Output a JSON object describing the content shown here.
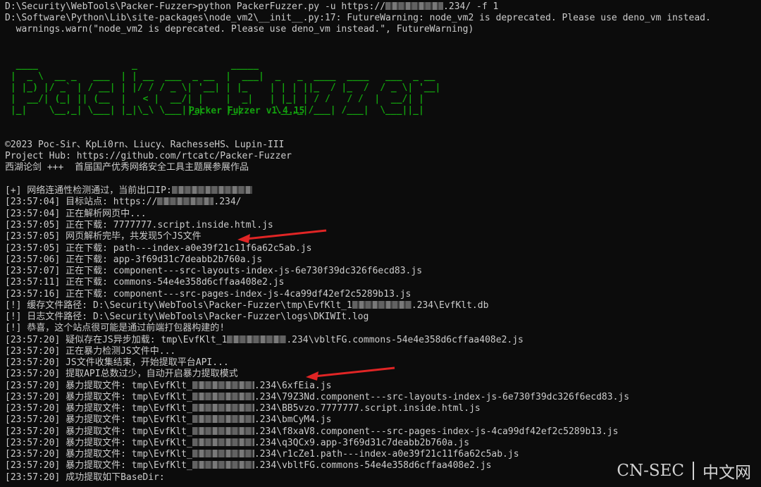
{
  "theme": {
    "background": "#0c0c0c",
    "foreground": "#cccccc",
    "banner_color": "#13a10e",
    "arrow_color": "#e02525"
  },
  "lines": [
    "D:\\Security\\WebTools\\Packer-Fuzzer>python PackerFuzzer.py -u https://",
    "D:\\Software\\Python\\Lib\\site-packages\\node_vm2\\__init__.py:17: FutureWarning: node_vm2 is deprecated. Please use deno_vm instead.",
    "  warnings.warn(\"node_vm2 is deprecated. Please use deno_vm instead.\", FutureWarning)",
    "©2023 Poc-Sir、KpLi0rn、Liucy、RachesseHS、Lupin-III",
    "Project Hub: https://github.com/rtcatc/Packer-Fuzzer",
    "西湖论剑 +++  首届国产优秀网络安全工具主题展参展作品",
    "[+] 网络连通性检测通过，当前出口IP:",
    "[23:57:04] 目标站点: https://",
    "[23:57:04] 正在解析网页中...",
    "[23:57:05] 正在下载: 7777777.script.inside.html.js",
    "[23:57:05] 网页解析完毕，共发现5个JS文件",
    "[23:57:05] 正在下载: path---index-a0e39f21c11f6a62c5ab.js",
    "[23:57:06] 正在下载: app-3f69d31c7deabb2b760a.js",
    "[23:57:07] 正在下载: component---src-layouts-index-js-6e730f39dc326f6ecd83.js",
    "[23:57:11] 正在下载: commons-54e4e358d6cffaa408e2.js",
    "[23:57:16] 正在下载: component---src-pages-index-js-4ca99df42ef2c5289b13.js",
    "[!] 缓存文件路径: D:\\Security\\WebTools\\Packer-Fuzzer\\tmp\\EvfKlt_1",
    "[!] 日志文件路径: D:\\Security\\WebTools\\Packer-Fuzzer\\logs\\DKIWIt.log",
    "[!] 恭喜，这个站点很可能是通过前端打包器构建的!",
    "[23:57:20] 疑似存在JS异步加载: tmp\\EvfKlt_1",
    "[23:57:20] 正在暴力检测JS文件中...",
    "[23:57:20] JS文件收集结束，开始提取平台API...",
    "[23:57:20] 提取API总数过少，自动开启暴力提取模式",
    "[23:57:20] 暴力提取文件: tmp\\EvfKlt_",
    "[23:57:20] 暴力提取文件: tmp\\EvfKlt_",
    "[23:57:20] 暴力提取文件: tmp\\EvfKlt_",
    "[23:57:20] 暴力提取文件: tmp\\EvfKlt_",
    "[23:57:20] 暴力提取文件: tmp\\EvfKlt_",
    "[23:57:20] 暴力提取文件: tmp\\EvfKlt_",
    "[23:57:20] 暴力提取文件: tmp\\EvfKlt_",
    "[23:57:20] 暴力提取文件: tmp\\EvfKlt_",
    "[23:57:20] 成功提取如下BaseDir:"
  ],
  "suffixes": [
    ".234/ -f 1",
    "",
    "",
    "",
    "",
    "",
    "",
    ".234/",
    "",
    "",
    "",
    "",
    "",
    "",
    "",
    "",
    ".234\\EvfKlt.db",
    "",
    "",
    ".234\\vbltFG.commons-54e4e358d6cffaa408e2.js",
    "",
    "",
    "",
    ".234\\6xfEia.js",
    ".234\\79Z3Nd.component---src-layouts-index-js-6e730f39dc326f6ecd83.js",
    ".234\\BB5vzo.7777777.script.inside.html.js",
    ".234\\bmCyM4.js",
    ".234\\f8xaV8.component---src-pages-index-js-4ca99df42ef2c5289b13.js",
    ".234\\q3QCx9.app-3f69d31c7deabb2b760a.js",
    ".234\\r1cZe1.path---index-a0e39f21c11f6a62c5ab.js",
    ".234\\vbltFG.commons-54e4e358d6cffaa408e2.js",
    ""
  ],
  "banner": {
    "art": [
      "  ____                 _                 _____                                ",
      " |  _ \\  __ _   ___  | | __  ___  _ __  |  ___|  _   _  ____  ____   ___  _ __ ",
      " | |_) |/ _` | / __| | |/ / / _ \\| '__| | |_    | | | ||_  / |_  /  / _ \\| '__|",
      " |  __/| (_| || (__  |   < |  __/| |    |  _|   | |_| | / /   / /  |  __/| |   ",
      " |_|    \\__,_| \\___| |_|\\_\\ \\___||_|    |_|      \\__,_|/___| /___|  \\___||_|   "
    ],
    "version": "Packer Fuzzer v1.4.15"
  },
  "watermark": {
    "left": "CN-SEC",
    "right": "中文网"
  }
}
